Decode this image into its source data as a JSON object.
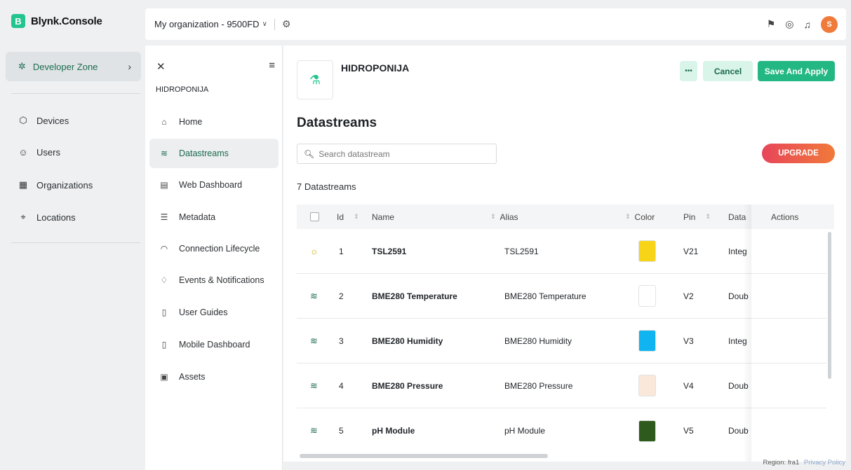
{
  "app": {
    "badge": "B",
    "name": "Blynk.Console"
  },
  "app_nav": {
    "dev_zone": "Developer Zone",
    "items": [
      {
        "label": "Devices",
        "icon": "cube-icon"
      },
      {
        "label": "Users",
        "icon": "users-icon"
      },
      {
        "label": "Organizations",
        "icon": "building-icon"
      },
      {
        "label": "Locations",
        "icon": "location-pin-icon"
      }
    ]
  },
  "topbar": {
    "org": "My organization - 9500FD",
    "avatar": "S"
  },
  "product": {
    "name": "HIDROPONIJA",
    "menu": [
      {
        "label": "Home",
        "icon": "home-icon"
      },
      {
        "label": "Datastreams",
        "icon": "datastream-icon"
      },
      {
        "label": "Web Dashboard",
        "icon": "dashboard-icon"
      },
      {
        "label": "Metadata",
        "icon": "list-icon"
      },
      {
        "label": "Connection Lifecycle",
        "icon": "wifi-icon"
      },
      {
        "label": "Events & Notifications",
        "icon": "bell-icon"
      },
      {
        "label": "User Guides",
        "icon": "book-icon"
      },
      {
        "label": "Mobile Dashboard",
        "icon": "phone-icon"
      },
      {
        "label": "Assets",
        "icon": "image-icon"
      }
    ],
    "active_index": 1
  },
  "main": {
    "template_name": "HIDROPONIJA",
    "more_label": "•••",
    "cancel_label": "Cancel",
    "save_label": "Save And Apply",
    "title": "Datastreams",
    "search_placeholder": "Search datastream",
    "upgrade_label": "UPGRADE",
    "count_label": "7 Datastreams"
  },
  "table": {
    "headers": {
      "id": "Id",
      "name": "Name",
      "alias": "Alias",
      "color": "Color",
      "pin": "Pin",
      "data": "Data",
      "actions": "Actions"
    },
    "rows": [
      {
        "id": "1",
        "name": "TSL2591",
        "alias": "TSL2591",
        "color": "#f7d417",
        "pin": "V21",
        "data": "Integ",
        "icon": "sun-icon"
      },
      {
        "id": "2",
        "name": "BME280 Temperature",
        "alias": "BME280 Temperature",
        "color": "#ffffff",
        "pin": "V2",
        "data": "Doub",
        "icon": "datastream-icon"
      },
      {
        "id": "3",
        "name": "BME280 Humidity",
        "alias": "BME280 Humidity",
        "color": "#10b4f0",
        "pin": "V3",
        "data": "Integ",
        "icon": "datastream-icon"
      },
      {
        "id": "4",
        "name": "BME280 Pressure",
        "alias": "BME280 Pressure",
        "color": "#fae8da",
        "pin": "V4",
        "data": "Doub",
        "icon": "datastream-icon"
      },
      {
        "id": "5",
        "name": "pH Module",
        "alias": "pH Module",
        "color": "#2e5a1e",
        "pin": "V5",
        "data": "Doub",
        "icon": "datastream-icon"
      }
    ]
  },
  "footer": {
    "region": "Region: fra1",
    "privacy": "Privacy Policy"
  },
  "colors": {
    "accent": "#23b883",
    "accent_light": "#d9f4e8",
    "brand_text": "#1b6b4d",
    "upgrade_from": "#e8455a",
    "upgrade_to": "#f07a3a"
  }
}
